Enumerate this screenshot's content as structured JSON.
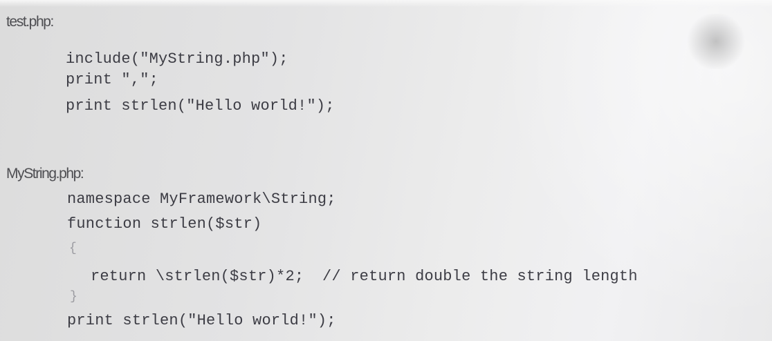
{
  "files": [
    {
      "name": "test.php:",
      "lines": [
        "include(\"MyString.php\");",
        "print \",\";",
        "print strlen(\"Hello world!\");"
      ]
    },
    {
      "name": "MyString.php:",
      "lines": [
        "namespace MyFramework\\String;",
        "function strlen($str)",
        "{",
        "return \\strlen($str)*2;  // return double the string length",
        "}",
        "print strlen(\"Hello world!\");"
      ]
    }
  ]
}
